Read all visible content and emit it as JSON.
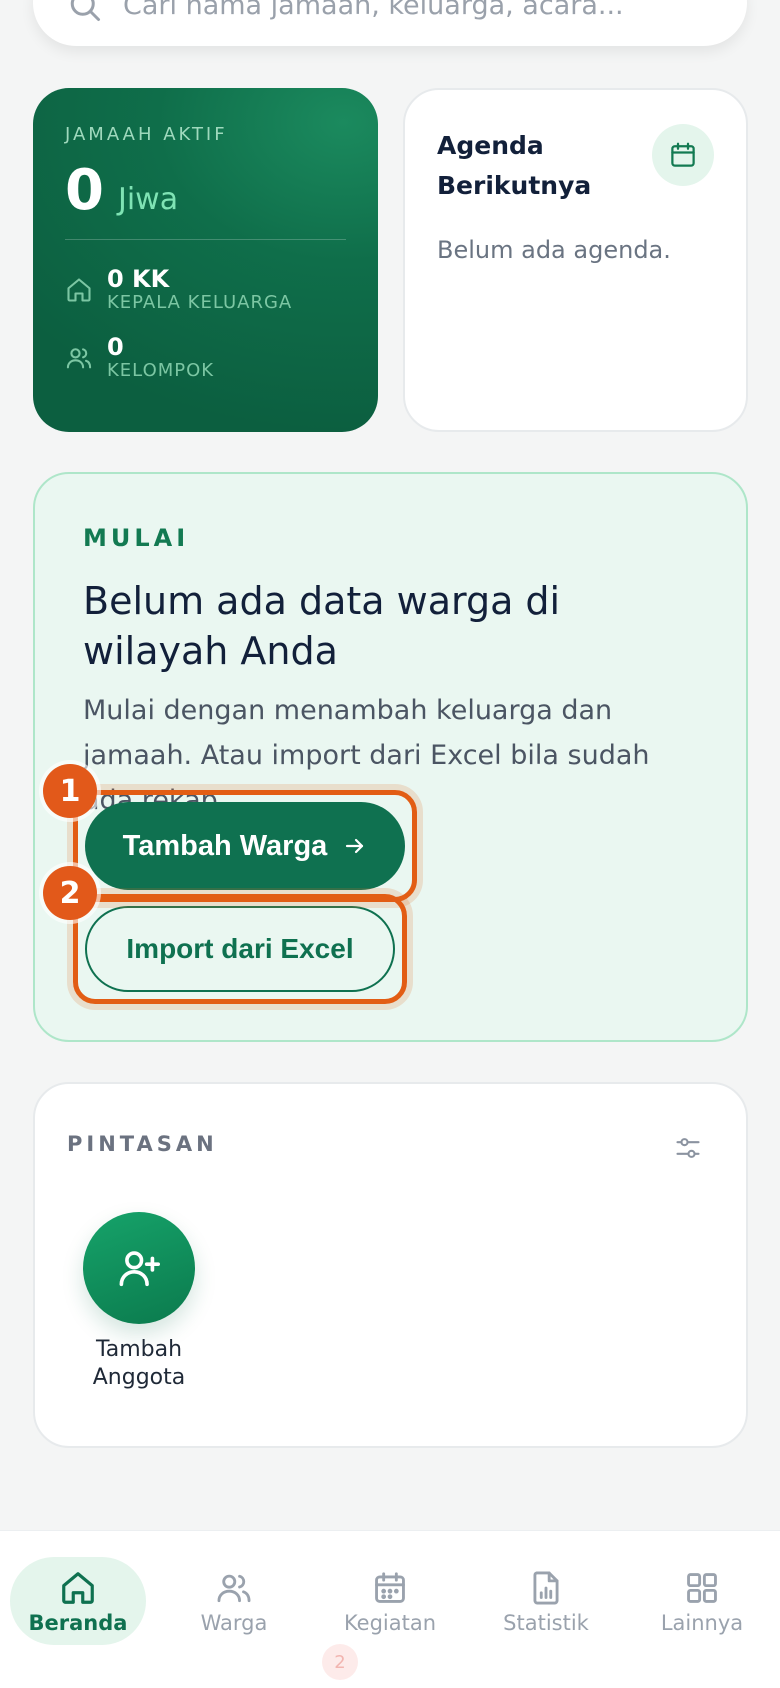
{
  "search": {
    "placeholder": "Cari nama jamaah, keluarga, acara..."
  },
  "stat_card": {
    "label": "JAMAAH AKTIF",
    "count": "0",
    "unit": "Jiwa",
    "kk_value": "0 KK",
    "kk_label": "KEPALA KELUARGA",
    "group_value": "0",
    "group_label": "KELOMPOK"
  },
  "agenda_card": {
    "title": "Agenda Berikutnya",
    "empty_text": "Belum ada agenda."
  },
  "start_card": {
    "kicker": "MULAI",
    "heading": "Belum ada data warga di wilayah Anda",
    "description": "Mulai dengan menambah keluarga dan jamaah. Atau import dari Excel bila sudah ada rekap.",
    "primary_button": "Tambah Warga",
    "secondary_button": "Import dari Excel",
    "badge_1": "1",
    "badge_2": "2"
  },
  "shortcuts": {
    "label": "PINTASAN",
    "items": [
      {
        "label": "Tambah Anggota"
      }
    ]
  },
  "nav": {
    "items": [
      {
        "label": "Beranda"
      },
      {
        "label": "Warga"
      },
      {
        "label": "Kegiatan"
      },
      {
        "label": "Statistik"
      },
      {
        "label": "Lainnya"
      }
    ]
  },
  "colors": {
    "brand": "#0f7150",
    "highlight": "#e25d14",
    "mint": "#eaf7f1"
  }
}
